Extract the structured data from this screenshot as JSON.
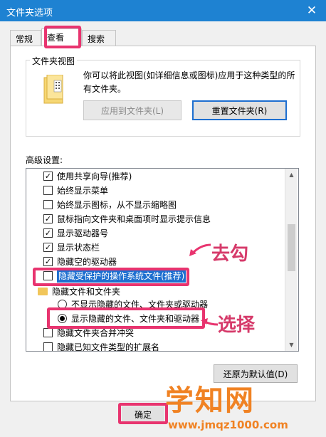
{
  "window": {
    "title": "文件夹选项",
    "close": "✕"
  },
  "tabs": [
    {
      "label": "常规"
    },
    {
      "label": "查看"
    },
    {
      "label": "搜索"
    }
  ],
  "folder_views": {
    "label": "文件夹视图",
    "description": "你可以将此视图(如详细信息或图标)应用于这种类型的所有文件夹。",
    "apply_button": "应用到文件夹(L)",
    "reset_button": "重置文件夹(R)"
  },
  "advanced": {
    "label": "高级设置:",
    "items": [
      {
        "type": "checkbox",
        "checked": true,
        "label": "使用共享向导(推荐)"
      },
      {
        "type": "checkbox",
        "checked": false,
        "label": "始终显示菜单"
      },
      {
        "type": "checkbox",
        "checked": false,
        "label": "始终显示图标，从不显示缩略图"
      },
      {
        "type": "checkbox",
        "checked": true,
        "label": "鼠标指向文件夹和桌面项时显示提示信息"
      },
      {
        "type": "checkbox",
        "checked": true,
        "label": "显示驱动器号"
      },
      {
        "type": "checkbox",
        "checked": true,
        "label": "显示状态栏"
      },
      {
        "type": "checkbox",
        "checked": true,
        "label": "隐藏空的驱动器"
      },
      {
        "type": "checkbox",
        "checked": false,
        "label": "隐藏受保护的操作系统文件(推荐)",
        "selected": true
      },
      {
        "type": "folder",
        "label": "隐藏文件和文件夹"
      },
      {
        "type": "radio",
        "checked": false,
        "label": "不显示隐藏的文件、文件夹或驱动器"
      },
      {
        "type": "radio",
        "checked": true,
        "label": "显示隐藏的文件、文件夹和驱动器"
      },
      {
        "type": "checkbox",
        "checked": false,
        "label": "隐藏文件夹合并冲突"
      },
      {
        "type": "checkbox",
        "checked": false,
        "label": "隐藏已知文件类型的扩展名"
      }
    ]
  },
  "restore_button": "还原为默认值(D)",
  "ok_button": "确定",
  "annotations": {
    "uncheck": "去勾",
    "select": "选择"
  },
  "watermark": {
    "main": "学知网",
    "sub": "www.jmqz1000.com"
  },
  "colors": {
    "titlebar": "#1e82d2",
    "highlight": "#e8346f",
    "watermark": "#f08223",
    "selection": "#1e6fd0"
  }
}
